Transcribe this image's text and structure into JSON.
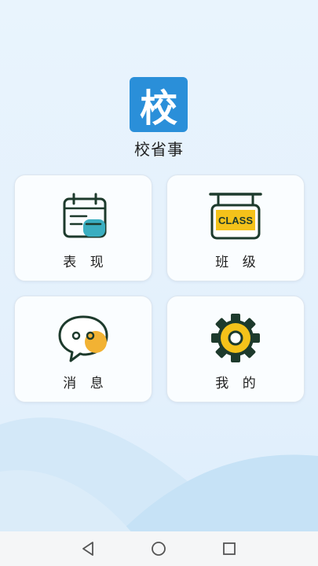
{
  "app": {
    "logo_char": "校",
    "name": "校省事"
  },
  "cards": [
    {
      "label": "表 现",
      "icon": "calendar-icon"
    },
    {
      "label": "班 级",
      "icon": "class-sign-icon",
      "sign_text": "CLASS"
    },
    {
      "label": "消 息",
      "icon": "chat-bubble-icon"
    },
    {
      "label": "我 的",
      "icon": "gear-icon"
    }
  ],
  "navbar": {
    "icons": [
      "back-triangle-icon",
      "home-circle-icon",
      "recent-square-icon"
    ]
  },
  "colors": {
    "logo_bg": "#2a8fd9",
    "icon_stroke": "#1d3a2c",
    "accent_teal": "#3aaec0",
    "accent_yellow": "#f4c21a",
    "accent_orange": "#f2b233"
  }
}
